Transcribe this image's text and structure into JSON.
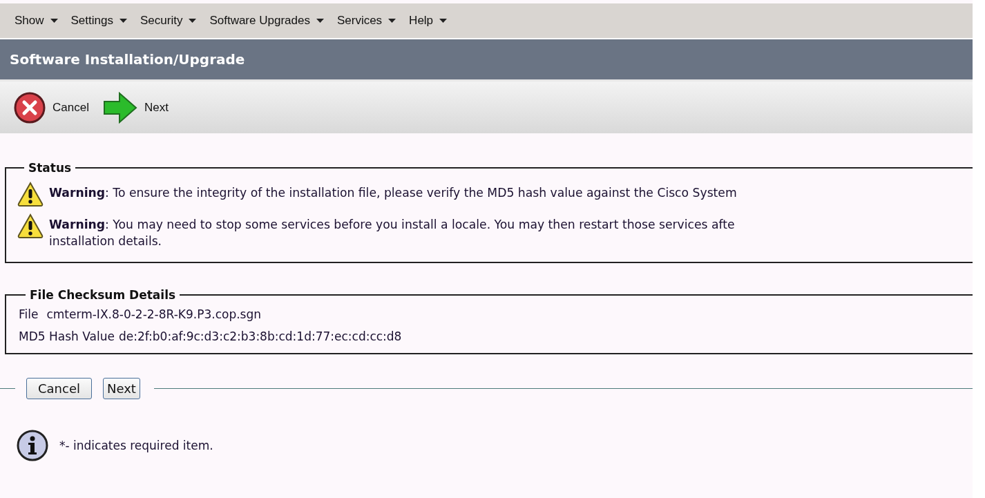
{
  "menu": [
    {
      "label": "Show"
    },
    {
      "label": "Settings"
    },
    {
      "label": "Security"
    },
    {
      "label": "Software Upgrades"
    },
    {
      "label": "Services"
    },
    {
      "label": "Help"
    }
  ],
  "page_title": "Software Installation/Upgrade",
  "toolbar": [
    {
      "kind": "cancel",
      "label": "Cancel"
    },
    {
      "kind": "next",
      "label": "Next"
    }
  ],
  "status": {
    "legend": "Status",
    "messages": [
      {
        "kind": "warning",
        "lines": [
          "**Warning**: To ensure the integrity of the installation file, please verify the MD5 hash value against the Cisco System"
        ]
      },
      {
        "kind": "warning",
        "lines": [
          "**Warning**: You may need to stop some services before you install a locale. You may then restart those services afte",
          "installation details."
        ]
      }
    ]
  },
  "checksum": {
    "legend": "File Checksum Details",
    "rows": [
      {
        "label": "File",
        "value": "cmterm-IX.8-0-2-2-8R-K9.P3.cop.sgn"
      },
      {
        "label": "MD5 Hash Value",
        "value": "de:2f:b0:af:9c:d3:c2:b3:8b:cd:1d:77:ec:cd:cc:d8"
      }
    ]
  },
  "buttons": [
    {
      "label": "Cancel"
    },
    {
      "label": "Next"
    }
  ],
  "note": "*- indicates required item."
}
